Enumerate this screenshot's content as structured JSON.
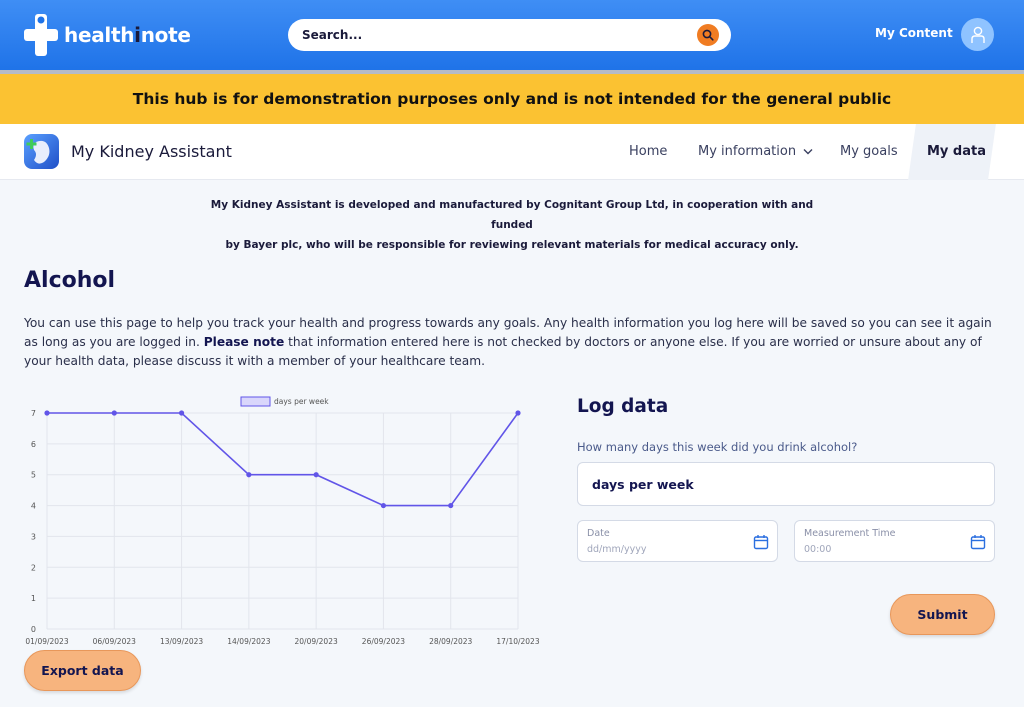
{
  "header": {
    "logo_prefix": "health",
    "logo_i": "i",
    "logo_suffix": "note",
    "search_placeholder": "Search...",
    "my_content": "My Content",
    "brand_color": "#1f73e8"
  },
  "banner": {
    "text": "This hub is for demonstration purposes only and is not intended for the general public",
    "color": "#fbc232"
  },
  "app": {
    "title": "My Kidney Assistant",
    "nav": {
      "home": "Home",
      "my_information": "My information",
      "my_goals": "My goals",
      "my_data": "My data"
    }
  },
  "disclaimer": {
    "line1": "My Kidney Assistant is developed and manufactured by Cognitant Group Ltd, in cooperation with and funded",
    "line2": "by Bayer plc, who will be responsible for reviewing relevant materials for medical accuracy only."
  },
  "page": {
    "title": "Alcohol",
    "intro_a": "You can use this page to help you track your health and progress towards any goals. Any health information you log here will be saved so you can see it again as long as you are logged in.",
    "intro_bold": "Please note",
    "intro_b": "that information entered here is not checked by doctors or anyone else. If you are worried or unsure about any of your health data, please discuss it with a member of your healthcare team."
  },
  "chart_data": {
    "type": "line",
    "categories": [
      "01/09/2023",
      "06/09/2023",
      "13/09/2023",
      "14/09/2023",
      "20/09/2023",
      "26/09/2023",
      "28/09/2023",
      "17/10/2023"
    ],
    "series": [
      {
        "name": "days per week",
        "values": [
          7,
          7,
          7,
          5,
          5,
          4,
          4,
          7
        ],
        "color": "#6155e8"
      }
    ],
    "ylim": [
      0,
      7
    ],
    "yticks": [
      "0",
      "1",
      "2",
      "3",
      "4",
      "5",
      "6",
      "7"
    ],
    "grid": true,
    "legend": "top-center"
  },
  "export_label": "Export data",
  "log": {
    "title": "Log data",
    "question": "How many days this week did you drink alcohol?",
    "value_placeholder": "days per week",
    "date_label": "Date",
    "date_placeholder": "dd/mm/yyyy",
    "time_label": "Measurement Time",
    "time_placeholder": "00:00",
    "submit_label": "Submit",
    "button_color": "#f7b47e"
  }
}
